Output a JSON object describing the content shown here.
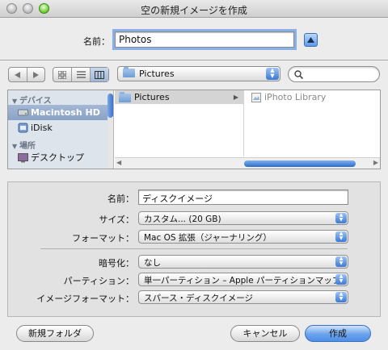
{
  "window": {
    "title": "空の新規イメージを作成"
  },
  "save_as": {
    "label": "名前：",
    "value": "Photos"
  },
  "toolbar": {
    "location": "Pictures",
    "search_placeholder": ""
  },
  "sidebar": {
    "devices_header": "デバイス",
    "places_header": "場所",
    "items": [
      {
        "label": "Macintosh HD",
        "icon": "hard-drive-icon",
        "selected": true
      },
      {
        "label": "iDisk",
        "icon": "idisk-icon",
        "selected": false
      },
      {
        "label": "デスクトップ",
        "icon": "desktop-icon",
        "selected": false
      }
    ]
  },
  "browser": {
    "column1": [
      {
        "label": "Pictures",
        "selected": true,
        "has_children": true
      }
    ],
    "column2": [
      {
        "label": "iPhoto Library",
        "selected": false
      }
    ]
  },
  "options": {
    "name_label": "名前：",
    "name_value": "ディスクイメージ",
    "size_label": "サイズ：",
    "size_value": "カスタム... (20 GB)",
    "format_label": "フォーマット：",
    "format_value": "Mac OS 拡張（ジャーナリング）",
    "encryption_label": "暗号化：",
    "encryption_value": "なし",
    "partition_label": "パーティション：",
    "partition_value": "単一パーティション – Apple パーティションマップ",
    "image_format_label": "イメージフォーマット：",
    "image_format_value": "スパース・ディスクイメージ"
  },
  "buttons": {
    "new_folder": "新規フォルダ",
    "cancel": "キャンセル",
    "create": "作成"
  },
  "colors": {
    "accent": "#5e9ae8",
    "selection": "#8aa2c6"
  }
}
